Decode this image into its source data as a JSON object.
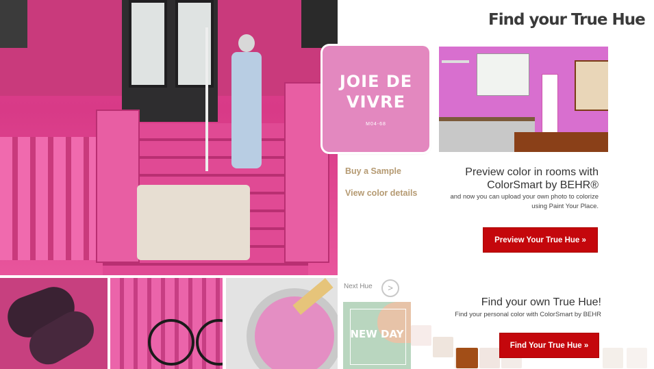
{
  "header": {
    "title": "Find your True Hue"
  },
  "swatch": {
    "name": "JOIE DE VIVRE",
    "code": "M04-68",
    "color": "#e388bf"
  },
  "links": {
    "buy_sample": "Buy a Sample",
    "view_details": "View color details"
  },
  "preview": {
    "title_line1": "Preview color in rooms with",
    "title_line2": "ColorSmart by BEHR®",
    "sub_line1": "and now you can upload your own photo to colorize",
    "sub_line2": "using Paint Your Place.",
    "button": "Preview Your True Hue »"
  },
  "next": {
    "label": "Next Hue",
    "arrow": ">",
    "thumb_name": "NEW DAY"
  },
  "find": {
    "title": "Find your own True Hue!",
    "sub": "Find your personal color with ColorSmart by BEHR",
    "button": "Find Your True Hue »"
  },
  "colors": {
    "accent_red": "#c4070c",
    "link_tan": "#b59a72",
    "pink": "#e04a94"
  }
}
